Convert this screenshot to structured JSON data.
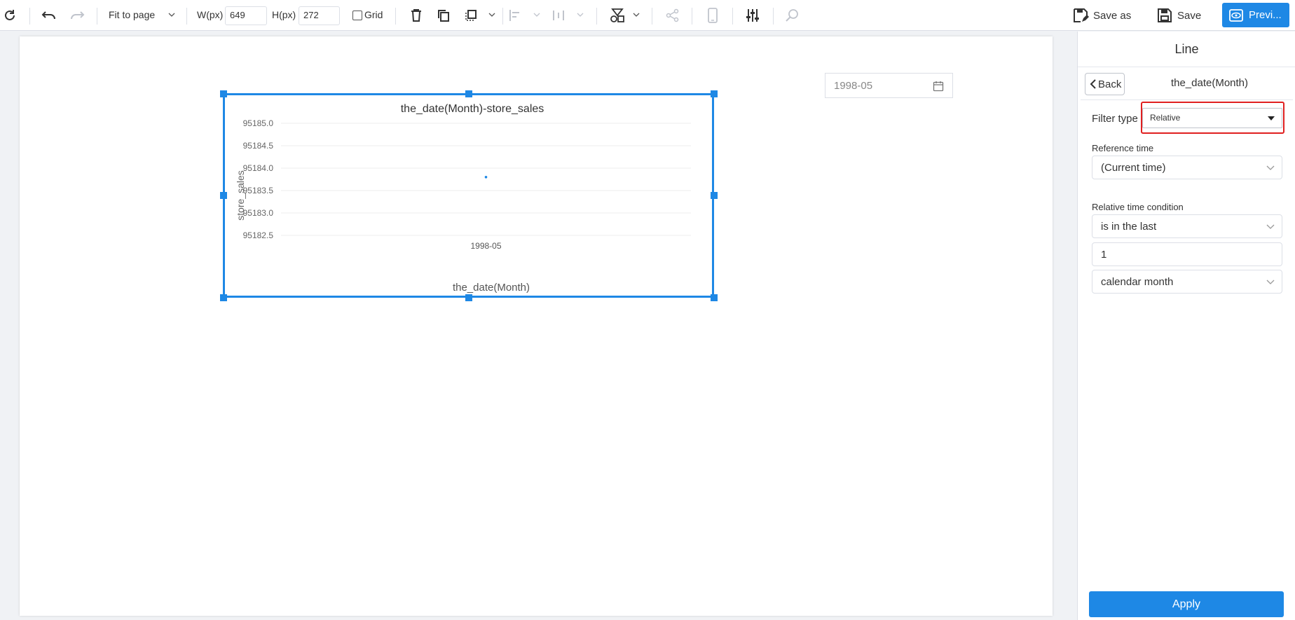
{
  "toolbar": {
    "fit_label": "Fit to page",
    "width_label": "W(px)",
    "width_value": "649",
    "height_label": "H(px)",
    "height_value": "272",
    "grid_label": "Grid",
    "save_as_label": "Save as",
    "save_label": "Save",
    "preview_label": "Previ..."
  },
  "date_filter": {
    "value": "1998-05"
  },
  "chart_data": {
    "type": "line",
    "title": "the_date(Month)-store_sales",
    "xlabel": "the_date(Month)",
    "ylabel": "store_sales",
    "categories": [
      "1998-05"
    ],
    "values": [
      95183.8
    ],
    "ylim": [
      95182.5,
      95185.0
    ],
    "yticks": [
      "95185.0",
      "95184.5",
      "95184.0",
      "95183.5",
      "95183.0",
      "95182.5"
    ],
    "color": "#1e88e5"
  },
  "panel": {
    "title": "Line",
    "back_label": "Back",
    "field_name": "the_date(Month)",
    "filter_type_label": "Filter type",
    "filter_type_value": "Relative",
    "reference_time_label": "Reference time",
    "reference_time_value": "(Current time)",
    "relative_condition_label": "Relative time condition",
    "condition_value": "is in the last",
    "amount_value": "1",
    "unit_value": "calendar month",
    "apply_label": "Apply"
  }
}
